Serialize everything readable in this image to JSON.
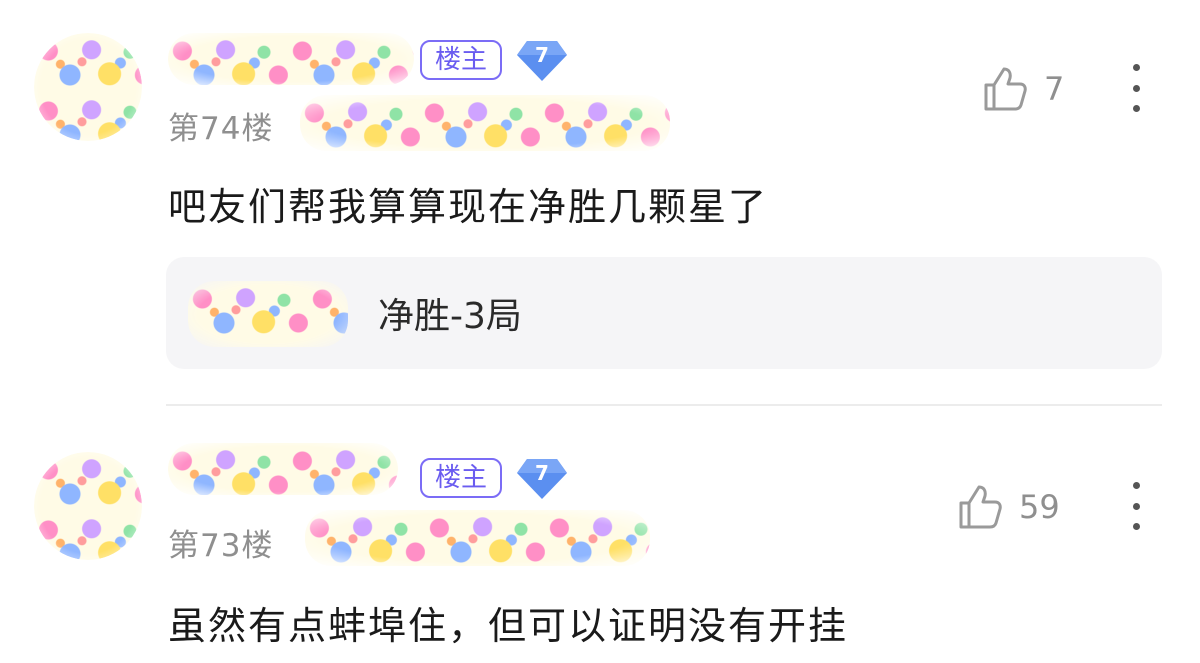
{
  "posts": [
    {
      "host_badge": "楼主",
      "level": "7",
      "floor": "第74楼",
      "likes": "7",
      "content": "吧友们帮我算算现在净胜几颗星了",
      "reply": {
        "text": "净胜-3局"
      }
    },
    {
      "host_badge": "楼主",
      "level": "7",
      "floor": "第73楼",
      "likes": "59",
      "content": "虽然有点蚌埠住，但可以证明没有开挂"
    }
  ],
  "colors": {
    "host_badge": "#7b6cf6",
    "level_badge": "#5b8ff0",
    "secondary_text": "#8f8f8f",
    "reply_bg": "#f5f5f7"
  },
  "icons": [
    "thumbs-up-icon",
    "more-vertical-icon",
    "level-diamond-icon"
  ]
}
